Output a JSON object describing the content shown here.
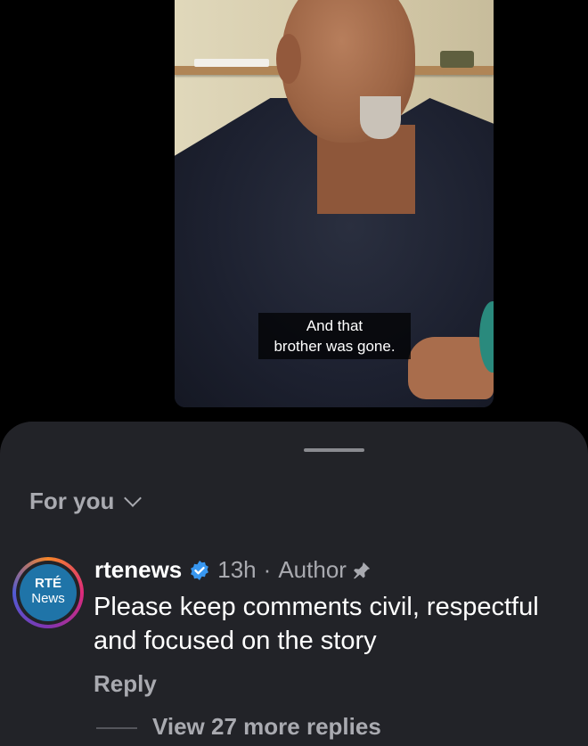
{
  "video": {
    "caption_line1": "And that",
    "caption_line2": "brother was gone."
  },
  "sheet": {
    "filter_label": "For you",
    "comment": {
      "avatar_line1": "RTÉ",
      "avatar_line2": "News",
      "username": "rtenews",
      "time": "13h",
      "separator": "·",
      "role": "Author",
      "text": "Please keep comments civil, respectful and focused on the story",
      "reply_label": "Reply",
      "more_replies": "View 27 more replies"
    }
  },
  "colors": {
    "sheet_bg": "#222328",
    "muted_text": "#a9aab0",
    "verified_blue": "#3897f0"
  },
  "icons": {
    "verified": "verified-badge-icon",
    "pin": "pin-icon",
    "chevron": "chevron-down-icon"
  }
}
